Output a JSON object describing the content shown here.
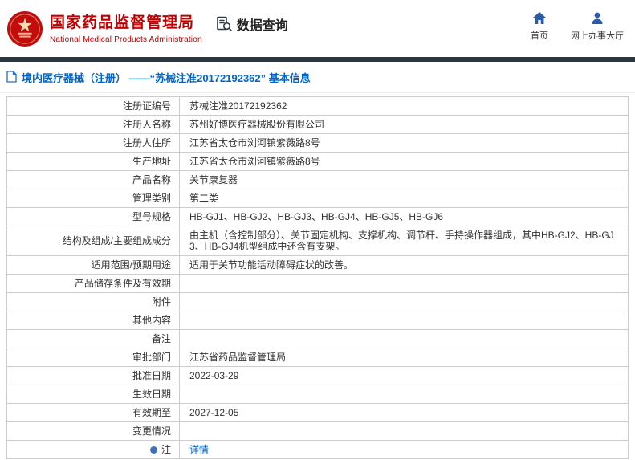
{
  "header": {
    "title_cn": "国家药品监督管理局",
    "title_en": "National Medical Products Administration",
    "section_label": "数据查询",
    "nav": [
      {
        "label": "首页",
        "icon": "home-icon"
      },
      {
        "label": "网上办事大厅",
        "icon": "user-icon"
      }
    ]
  },
  "page": {
    "title": "境内医疗器械（注册） ——“苏械注准20172192362” 基本信息"
  },
  "table": {
    "rows": [
      {
        "label": "注册证编号",
        "value": "苏械注准20172192362"
      },
      {
        "label": "注册人名称",
        "value": "苏州好博医疗器械股份有限公司"
      },
      {
        "label": "注册人住所",
        "value": "江苏省太仓市浏河镇紫薇路8号"
      },
      {
        "label": "生产地址",
        "value": "江苏省太仓市浏河镇紫薇路8号"
      },
      {
        "label": "产品名称",
        "value": "关节康复器"
      },
      {
        "label": "管理类别",
        "value": "第二类"
      },
      {
        "label": "型号规格",
        "value": "HB-GJ1、HB-GJ2、HB-GJ3、HB-GJ4、HB-GJ5、HB-GJ6"
      },
      {
        "label": "结构及组成/主要组成成分",
        "value": "由主机（含控制部分）、关节固定机构、支撑机构、调节杆、手持操作器组成，其中HB-GJ2、HB-GJ3、HB-GJ4机型组成中还含有支架。"
      },
      {
        "label": "适用范围/预期用途",
        "value": "适用于关节功能活动障碍症状的改善。"
      },
      {
        "label": "产品储存条件及有效期",
        "value": ""
      },
      {
        "label": "附件",
        "value": ""
      },
      {
        "label": "其他内容",
        "value": ""
      },
      {
        "label": "备注",
        "value": ""
      },
      {
        "label": "审批部门",
        "value": "江苏省药品监督管理局"
      },
      {
        "label": "批准日期",
        "value": "2022-03-29"
      },
      {
        "label": "生效日期",
        "value": ""
      },
      {
        "label": "有效期至",
        "value": "2027-12-05"
      },
      {
        "label": "变更情况",
        "value": ""
      },
      {
        "label": "注",
        "value": "详情"
      }
    ]
  },
  "colors": {
    "brand_red": "#c00000",
    "title_blue": "#0066cc",
    "link_blue": "#0066cc",
    "icon_blue": "#2a5caa",
    "divider_dark": "#2c3540",
    "table_border": "#cccccc"
  }
}
